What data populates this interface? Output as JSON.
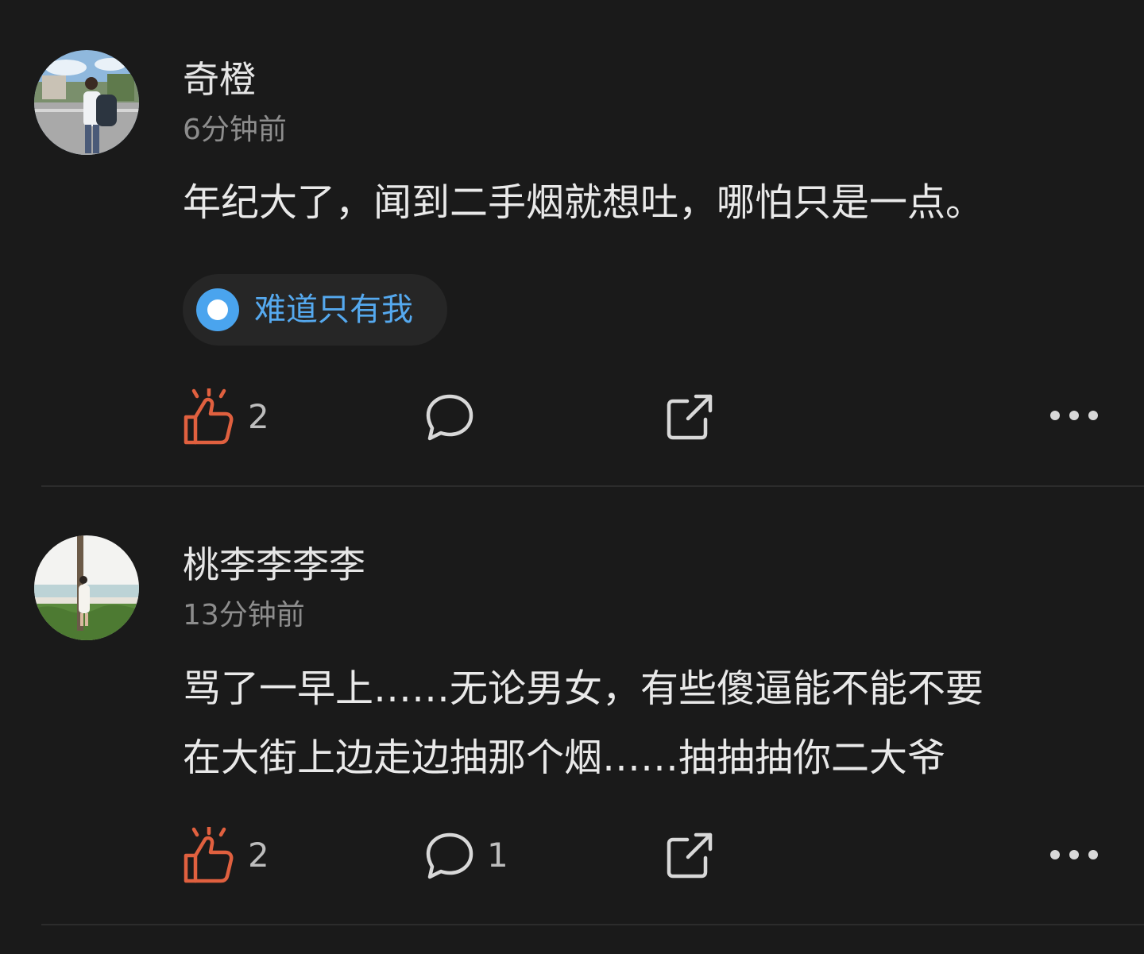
{
  "posts": [
    {
      "author": "奇橙",
      "time": "6分钟前",
      "text_lines": [
        "年纪大了，闻到二手烟就想吐，哪怕只是一点。"
      ],
      "topic": "难道只有我",
      "likes": "2",
      "comments": "",
      "icons": [
        "thumbs-up-icon",
        "comment-icon",
        "share-icon",
        "more-icon"
      ]
    },
    {
      "author": "桃李李李李",
      "time": "13分钟前",
      "text_lines": [
        "骂了一早上……无论男女，有些傻逼能不能不要",
        "在大街上边走边抽那个烟……抽抽抽你二大爷"
      ],
      "likes": "2",
      "comments": "1",
      "icons": [
        "thumbs-up-icon",
        "comment-icon",
        "share-icon",
        "more-icon"
      ]
    }
  ],
  "colors": {
    "background": "#1a1a1a",
    "like_accent": "#e0603f",
    "topic_text": "#55a9ef",
    "secondary_text": "#8d8d8d"
  }
}
